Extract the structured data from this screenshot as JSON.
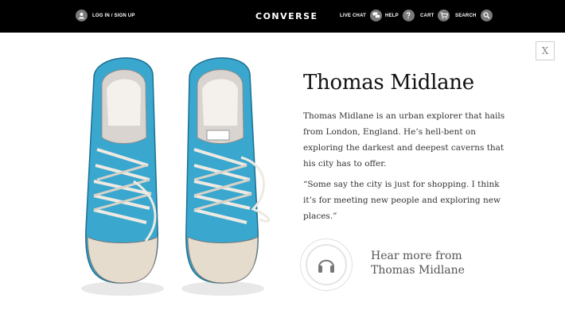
{
  "header": {
    "login_label": "LOG IN / SIGN UP",
    "logo": "CONVERSE",
    "live_chat_label": "LIVE CHAT",
    "help_label": "HELP",
    "cart_label": "CART",
    "search_label": "SEARCH",
    "icons": [
      "user-icon",
      "chat-bubbles-icon",
      "question-icon",
      "cart-icon",
      "search-icon"
    ]
  },
  "modal": {
    "close_label": "X",
    "title": "Thomas Midlane",
    "bio": "Thomas Midlane is an urban explorer that hails from London, England. He’s hell-bent on exploring the darkest and deepest caverns that his city has to offer.",
    "quote": "“Some say the city is just for shopping. I think it’s for meeting new people and exploring new places.”",
    "hear_more_line1": "Hear more from",
    "hear_more_line2": "Thomas Midlane",
    "image_alt": "worn-blue-converse-sneakers",
    "colors": {
      "topbar": "#000000",
      "shoe_blue": "#3aa7cf",
      "icon_circle": "#7a7a7a"
    }
  }
}
